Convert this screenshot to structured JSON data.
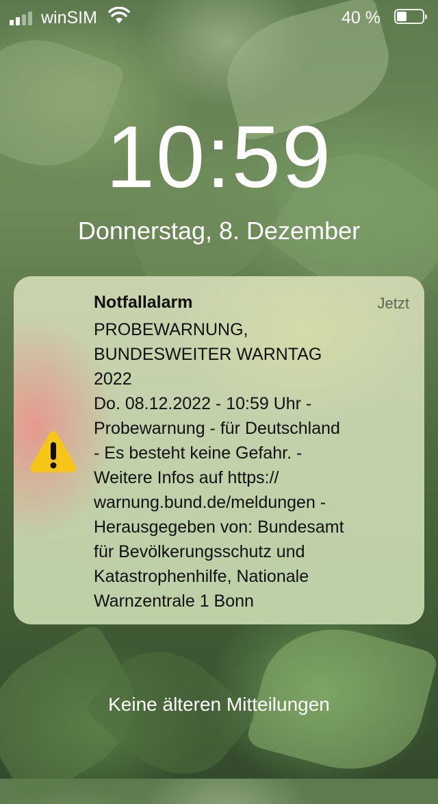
{
  "status_bar": {
    "carrier": "winSIM",
    "battery_percent": "40 %",
    "battery_level": 0.4,
    "signal_icon": "cellular-signal-icon",
    "wifi_icon": "wifi-icon",
    "battery_icon": "battery-icon"
  },
  "lock_screen": {
    "time": "10:59",
    "date": "Donnerstag, 8. Dezember"
  },
  "notification": {
    "title": "Notfallalarm",
    "time": "Jetzt",
    "icon": "warning-triangle-icon",
    "body": "PROBEWARNUNG,\nBUNDESWEITER WARNTAG\n2022\nDo. 08.12.2022 - 10:59 Uhr -\nProbewarnung - für Deutschland\n- Es besteht keine Gefahr. -\nWeitere Infos auf https://\nwarnung.bund.de/meldungen -\nHerausgegeben von: Bundesamt\nfür Bevölkerungsschutz und\nKatastrophenhilfe, Nationale\nWarnzentrale 1 Bonn",
    "colors": {
      "warning": "#f5c518"
    }
  },
  "footer": {
    "no_older": "Keine älteren Mitteilungen"
  }
}
